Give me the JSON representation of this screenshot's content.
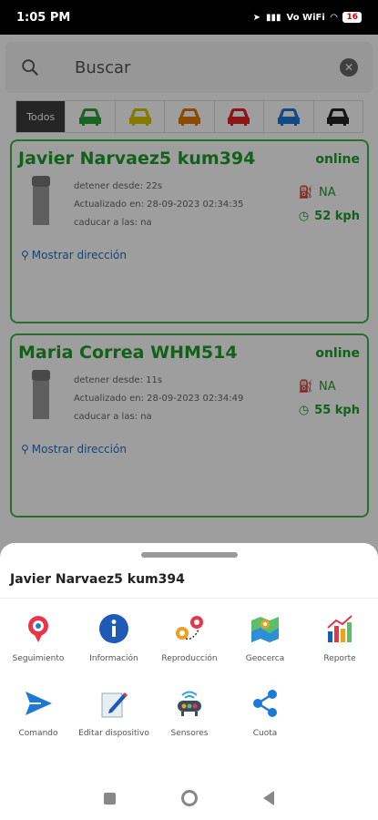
{
  "status_bar": {
    "time": "1:05 PM",
    "battery": "16",
    "network": "Vo WiFi"
  },
  "search": {
    "placeholder": "Buscar",
    "clear_icon": "clear-icon"
  },
  "filters": {
    "all_label": "Todos",
    "car_colors": [
      "#2fa13d",
      "#d8c400",
      "#e07a00",
      "#e02424",
      "#1e78d6",
      "#222222"
    ]
  },
  "vehicles": [
    {
      "name": "Javier Narvaez5 kum394",
      "status": "online",
      "stopped": "detener desde: 22s",
      "updated": "Actualizado en: 28-09-2023 02:34:35",
      "expires": "caducar a las: na",
      "fuel": "NA",
      "speed": "52 kph",
      "address_link": "Mostrar dirección"
    },
    {
      "name": "Maria Correa WHM514",
      "status": "online",
      "stopped": "detener desde: 11s",
      "updated": "Actualizado en: 28-09-2023 02:34:49",
      "expires": "caducar a las: na",
      "fuel": "NA",
      "speed": "55 kph",
      "address_link": "Mostrar dirección"
    }
  ],
  "sheet": {
    "title": "Javier Narvaez5 kum394",
    "actions": [
      {
        "label": "Seguimiento",
        "icon": "tracking-pin-icon"
      },
      {
        "label": "Información",
        "icon": "info-icon"
      },
      {
        "label": "Reproducción",
        "icon": "route-playback-icon"
      },
      {
        "label": "Geocerca",
        "icon": "geofence-map-icon"
      },
      {
        "label": "Reporte",
        "icon": "report-chart-icon"
      },
      {
        "label": "Comando",
        "icon": "send-command-icon"
      },
      {
        "label": "Editar dispositivo",
        "icon": "edit-device-icon"
      },
      {
        "label": "Sensores",
        "icon": "sensors-icon"
      },
      {
        "label": "Cuota",
        "icon": "share-icon"
      }
    ]
  },
  "colors": {
    "accent_green": "#1f9b2a",
    "link_blue": "#1e6fc7"
  }
}
